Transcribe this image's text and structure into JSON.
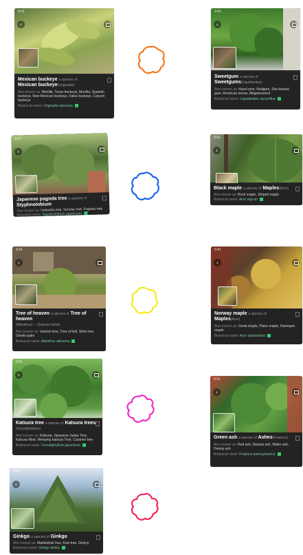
{
  "phone_status": "9:41",
  "labels": {
    "aka_prefix": "Also known as:",
    "botanical_prefix": "Botanical name:",
    "species_of": "a species of"
  },
  "cards": [
    {
      "id": "mexican-buckeye",
      "name": "Mexican buckeye",
      "parent": "Mexican buckeye",
      "parent_sci": "(Ungnadia)",
      "aka": "Mexilla, Texas buckeye, Monilla, Spanish buckeye, New Mexican buckeye, False buckeye, Canyon buckeye",
      "botanical": "Ungnadia speciosa",
      "photo_colors": [
        "#7f9a46",
        "#c9d179",
        "#58753a"
      ]
    },
    {
      "id": "sweetgum",
      "name": "Sweetgum",
      "parent": "Sweetgums",
      "parent_sci": "(Liquidambar)",
      "aka": "Hazel pine, Redgum, Star-leaved gum, American storax, Alligatorwood",
      "botanical": "Liquidambar styraciflua",
      "photo_colors": [
        "#3d7a2a",
        "#6ea744",
        "#c9c9c4"
      ]
    },
    {
      "id": "japanese-pagoda",
      "name": "Japanese pagoda tree",
      "parent": "Styphnolobium",
      "parent_sci": "",
      "aka": "Umbrella tree, Scholar tree, Pagoda tree",
      "botanical": "Styphnolobium japonicum",
      "photo_colors": [
        "#4d6e34",
        "#a9bf7a",
        "#8b5b4a"
      ]
    },
    {
      "id": "black-maple",
      "name": "Black maple",
      "parent": "Maples",
      "parent_sci": "(Acer)",
      "aka": "Rock maple, Striped maple",
      "botanical": "Acer nigrum",
      "photo_colors": [
        "#3e6028",
        "#7aa04c",
        "#8c8a7e"
      ]
    },
    {
      "id": "tree-of-heaven",
      "name": "Tree of heaven",
      "parent": "Tree of heaven",
      "parent_sci": "(Ailanthus) — Quassia family",
      "aka": "Varnish tree, Tree of hell, Stink tree, Ghetto palm",
      "botanical": "Ailanthus altissima",
      "photo_colors": [
        "#6d8a3c",
        "#b9a881",
        "#5d4a36"
      ]
    },
    {
      "id": "norway-maple",
      "name": "Norway maple",
      "parent": "Maples",
      "parent_sci": "(Acer)",
      "aka": "Great maple, Plane maple, Harlequin maple",
      "botanical": "Acer platanoides",
      "photo_colors": [
        "#8a3a2a",
        "#c8a23c",
        "#59402b"
      ]
    },
    {
      "id": "katsura",
      "name": "Katsura tree",
      "parent": "Katsura trees",
      "parent_sci": "(Cercidiphyllum)",
      "aka": "Katsura, Japanese Judas Tree, Katsura Nine, Weeping katsura Tree, Caramel tree",
      "botanical": "Cercidiphyllum japonicum",
      "photo_colors": [
        "#3c7a2e",
        "#7fb95a",
        "#d8e6d2"
      ]
    },
    {
      "id": "green-ash",
      "name": "Green ash",
      "parent": "Ashes",
      "parent_sci": "(Fraxinus)",
      "aka": "Red ash, Swamp ash, Water ash, Downy ash",
      "botanical": "Fraxinus pennsylvanica",
      "photo_colors": [
        "#2f6a2a",
        "#65a044",
        "#b8463a"
      ]
    },
    {
      "id": "ginkgo",
      "name": "Ginkgo",
      "parent": "Ginkgo",
      "parent_sci": "",
      "aka": "Maidenhair tree, Kew tree, Ginkyo",
      "botanical": "Ginkgo biloba",
      "photo_colors": [
        "#4b6e34",
        "#9bb6cf",
        "#dde6ef"
      ]
    }
  ],
  "annotations": [
    {
      "id": "orange",
      "color": "#f47a20"
    },
    {
      "id": "blue",
      "color": "#1b62f0"
    },
    {
      "id": "yellow",
      "color": "#f4ea1e"
    },
    {
      "id": "magenta",
      "color": "#ee2cc8"
    },
    {
      "id": "crimson",
      "color": "#ef2757"
    }
  ]
}
